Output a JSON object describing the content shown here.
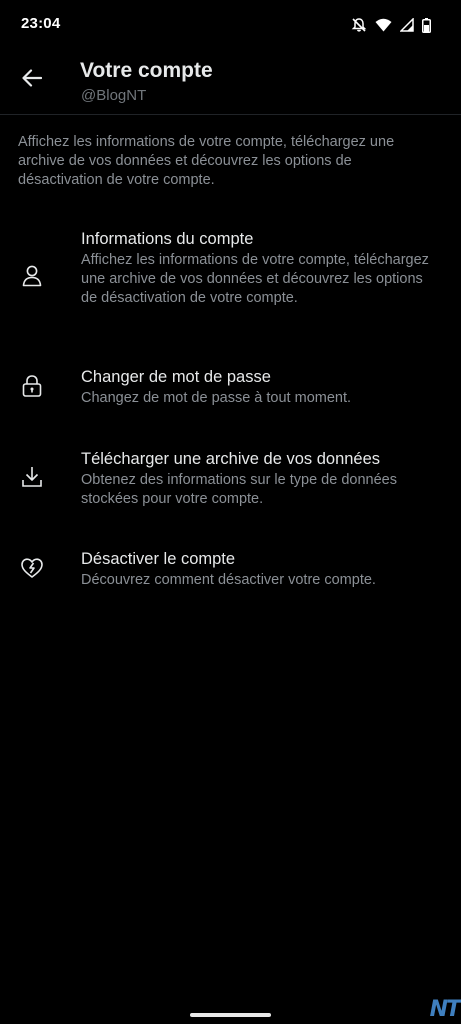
{
  "status_bar": {
    "time": "23:04",
    "icons": [
      "notifications-off-icon",
      "wifi-icon",
      "signal-icon",
      "battery-icon"
    ]
  },
  "header": {
    "title": "Votre compte",
    "subtitle": "@BlogNT",
    "back_icon": "arrow-left-icon"
  },
  "description": "Affichez les informations de votre compte, téléchargez une archive de vos données et découvrez les options de désactivation de votre compte.",
  "menu": {
    "items": [
      {
        "icon": "person-icon",
        "title": "Informations du compte",
        "desc": "Affichez les informations de votre compte, téléchargez une archive de vos données et découvrez les options de désactivation de votre compte."
      },
      {
        "icon": "lock-icon",
        "title": "Changer de mot de passe",
        "desc": "Changez de mot de passe à tout moment."
      },
      {
        "icon": "download-icon",
        "title": "Télécharger une archive de vos données",
        "desc": "Obtenez des informations sur le type de données stockées pour votre compte."
      },
      {
        "icon": "broken-heart-icon",
        "title": "Désactiver le compte",
        "desc": "Découvrez comment désactiver votre compte."
      }
    ]
  },
  "watermark": "NT",
  "colors": {
    "background": "#000000",
    "primary_text": "#e7e9ea",
    "secondary_text": "#8b9096",
    "divider": "#202327"
  }
}
